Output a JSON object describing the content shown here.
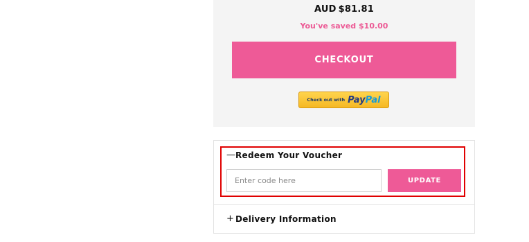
{
  "summary": {
    "currency": "AUD",
    "total": "$81.81",
    "saved_text": "You've saved $10.00",
    "checkout_label": "CHECKOUT",
    "paypal": {
      "prefix": "Check out with",
      "brand_pay": "Pay",
      "brand_pal": "Pal"
    }
  },
  "voucher": {
    "sign": "—",
    "title": "Redeem Your Voucher",
    "input_value": "",
    "input_placeholder": "Enter code here",
    "update_label": "UPDATE",
    "expanded": true
  },
  "delivery": {
    "sign": "+",
    "title": "Delivery Information",
    "expanded": false
  },
  "colors": {
    "accent": "#ee5a97",
    "saved_text": "#ec5a95",
    "highlight_border": "#e00000",
    "panel_bg": "#f4f4f4"
  },
  "icons": {
    "voucher_toggle": "minus-icon",
    "delivery_toggle": "plus-icon"
  }
}
